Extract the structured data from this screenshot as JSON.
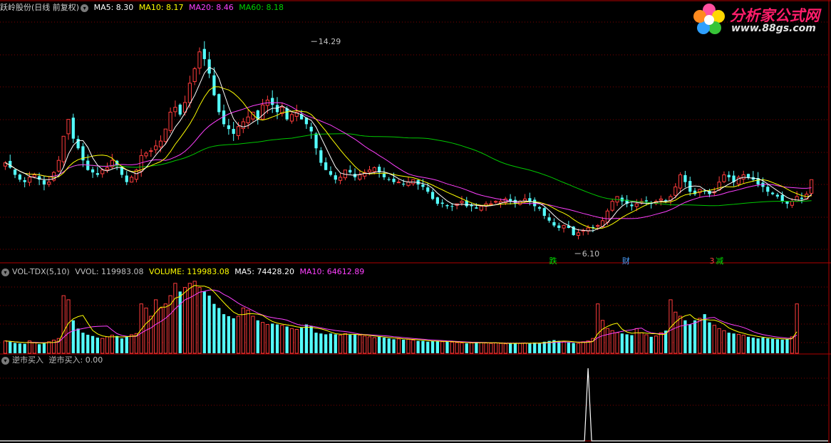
{
  "main_header": {
    "title": "跃岭股份(日线 前复权)",
    "ma5_label": "MA5: 8.30",
    "ma10_label": "MA10: 8.17",
    "ma20_label": "MA20: 8.46",
    "ma60_label": "MA60: 8.18"
  },
  "vol_header": {
    "title": "VOL-TDX(5,10)",
    "vvol_label": "VVOL: 119983.08",
    "volume_label": "VOLUME: 119983.08",
    "ma5_label": "MA5: 74428.20",
    "ma10_label": "MA10: 64612.89"
  },
  "ind_header": {
    "title": "逆市买入",
    "value_label": "逆市买入: 0.00"
  },
  "logo": {
    "brand": "分析家公式网",
    "url": "www.88gs.com"
  },
  "colors": {
    "up": "#ff3c3c",
    "down": "#54ffff",
    "ma5": "#ffffff",
    "ma10": "#ffff00",
    "ma20": "#ff40ff",
    "ma60": "#00c800",
    "grid": "#800000",
    "axis": "#b00000"
  },
  "chart_data": [
    {
      "type": "candlestick",
      "title": "跃岭股份(日线 前复权)",
      "price_range": [
        5.2,
        15.3
      ],
      "annotations": [
        {
          "label": "14.29",
          "kind": "high",
          "value": 14.29
        },
        {
          "label": "6.10",
          "kind": "low",
          "value": 6.1
        },
        {
          "label": "跌",
          "kind": "marker"
        },
        {
          "label": "财",
          "kind": "marker"
        },
        {
          "label": "3",
          "kind": "marker"
        },
        {
          "label": "减",
          "kind": "marker"
        }
      ],
      "series_info": [
        {
          "name": "MA5",
          "value": 8.3
        },
        {
          "name": "MA10",
          "value": 8.17
        },
        {
          "name": "MA20",
          "value": 8.46
        },
        {
          "name": "MA60",
          "value": 8.18
        }
      ],
      "close": [
        9.2,
        9.0,
        8.7,
        8.5,
        8.4,
        8.6,
        8.7,
        8.5,
        8.3,
        8.4,
        8.8,
        9.3,
        10.3,
        11.0,
        10.2,
        9.8,
        9.3,
        8.9,
        8.8,
        8.7,
        8.9,
        9.0,
        9.3,
        9.1,
        8.7,
        8.4,
        8.6,
        8.9,
        9.5,
        9.6,
        9.7,
        9.9,
        10.1,
        10.6,
        11.3,
        11.5,
        11.2,
        11.7,
        12.5,
        13.1,
        13.8,
        13.5,
        12.9,
        12.0,
        11.3,
        10.8,
        10.6,
        10.4,
        10.7,
        10.9,
        11.1,
        11.3,
        11.0,
        11.6,
        11.8,
        11.6,
        11.3,
        11.5,
        11.0,
        11.2,
        11.3,
        11.0,
        10.8,
        10.5,
        9.8,
        9.2,
        8.9,
        8.7,
        8.5,
        8.6,
        8.9,
        8.8,
        8.6,
        8.7,
        8.8,
        8.9,
        9.0,
        8.8,
        8.6,
        8.5,
        8.4,
        8.4,
        8.3,
        8.4,
        8.5,
        8.3,
        8.2,
        8.0,
        7.7,
        7.5,
        7.5,
        7.4,
        7.4,
        7.5,
        7.6,
        7.4,
        7.4,
        7.3,
        7.4,
        7.5,
        7.5,
        7.6,
        7.6,
        7.7,
        7.6,
        7.5,
        7.6,
        7.7,
        7.6,
        7.4,
        7.3,
        7.0,
        6.8,
        6.6,
        6.5,
        6.6,
        6.5,
        6.2,
        6.3,
        6.4,
        6.5,
        6.5,
        6.6,
        6.8,
        7.2,
        7.6,
        7.8,
        7.6,
        7.5,
        7.4,
        7.5,
        7.6,
        7.6,
        7.5,
        7.6,
        7.7,
        7.6,
        7.8,
        8.2,
        8.7,
        8.4,
        8.0,
        7.9,
        8.1,
        8.0,
        7.9,
        8.0,
        8.4,
        8.7,
        8.6,
        8.4,
        8.6,
        8.7,
        8.6,
        8.5,
        8.3,
        8.2,
        8.0,
        7.9,
        7.8,
        7.6,
        7.5,
        7.6,
        7.8,
        7.7,
        7.9,
        8.5
      ],
      "volume": [
        30000,
        28000,
        25000,
        24000,
        23000,
        30000,
        26000,
        22000,
        24000,
        28000,
        32000,
        36000,
        140000,
        130000,
        80000,
        60000,
        50000,
        45000,
        42000,
        38000,
        36000,
        40000,
        44000,
        42000,
        36000,
        40000,
        45000,
        48000,
        120000,
        110000,
        90000,
        130000,
        110000,
        120000,
        140000,
        170000,
        150000,
        160000,
        170000,
        175000,
        160000,
        150000,
        140000,
        120000,
        110000,
        95000,
        90000,
        85000,
        90000,
        110000,
        105000,
        90000,
        80000,
        75000,
        70000,
        72000,
        70000,
        68000,
        65000,
        60000,
        58000,
        62000,
        70000,
        66000,
        50000,
        48000,
        46000,
        48000,
        46000,
        44000,
        48000,
        45000,
        46000,
        44000,
        42000,
        40000,
        38000,
        40000,
        38000,
        36000,
        34000,
        35000,
        33000,
        34000,
        32000,
        30000,
        30000,
        28000,
        30000,
        29000,
        28000,
        28000,
        27000,
        26000,
        25000,
        24000,
        25000,
        27000,
        26000,
        25000,
        24000,
        25000,
        24000,
        23000,
        24000,
        25000,
        24000,
        25000,
        24000,
        26000,
        25000,
        28000,
        30000,
        32000,
        30000,
        28000,
        26000,
        25000,
        24000,
        28000,
        30000,
        36000,
        120000,
        80000,
        60000,
        55000,
        50000,
        48000,
        46000,
        44000,
        60000,
        50000,
        45000,
        40000,
        42000,
        50000,
        55000,
        130000,
        100000,
        90000,
        80000,
        70000,
        80000,
        85000,
        95000,
        75000,
        68000,
        60000,
        55000,
        50000,
        48000,
        46000,
        44000,
        40000,
        38000,
        36000,
        38000,
        36000,
        35000,
        34000,
        33000,
        34000,
        40000,
        119983.08
      ]
    },
    {
      "type": "bar",
      "title": "VOL-TDX(5,10)",
      "series_info": [
        {
          "name": "VVOL",
          "value": 119983.08
        },
        {
          "name": "VOLUME",
          "value": 119983.08
        },
        {
          "name": "MA5",
          "value": 74428.2
        },
        {
          "name": "MA10",
          "value": 64612.89
        }
      ]
    },
    {
      "type": "line",
      "title": "逆市买入",
      "series_info": [
        {
          "name": "逆市买入",
          "value": 0.0
        }
      ],
      "spike_index": 120,
      "values_note_range": [
        0,
        1
      ]
    }
  ]
}
